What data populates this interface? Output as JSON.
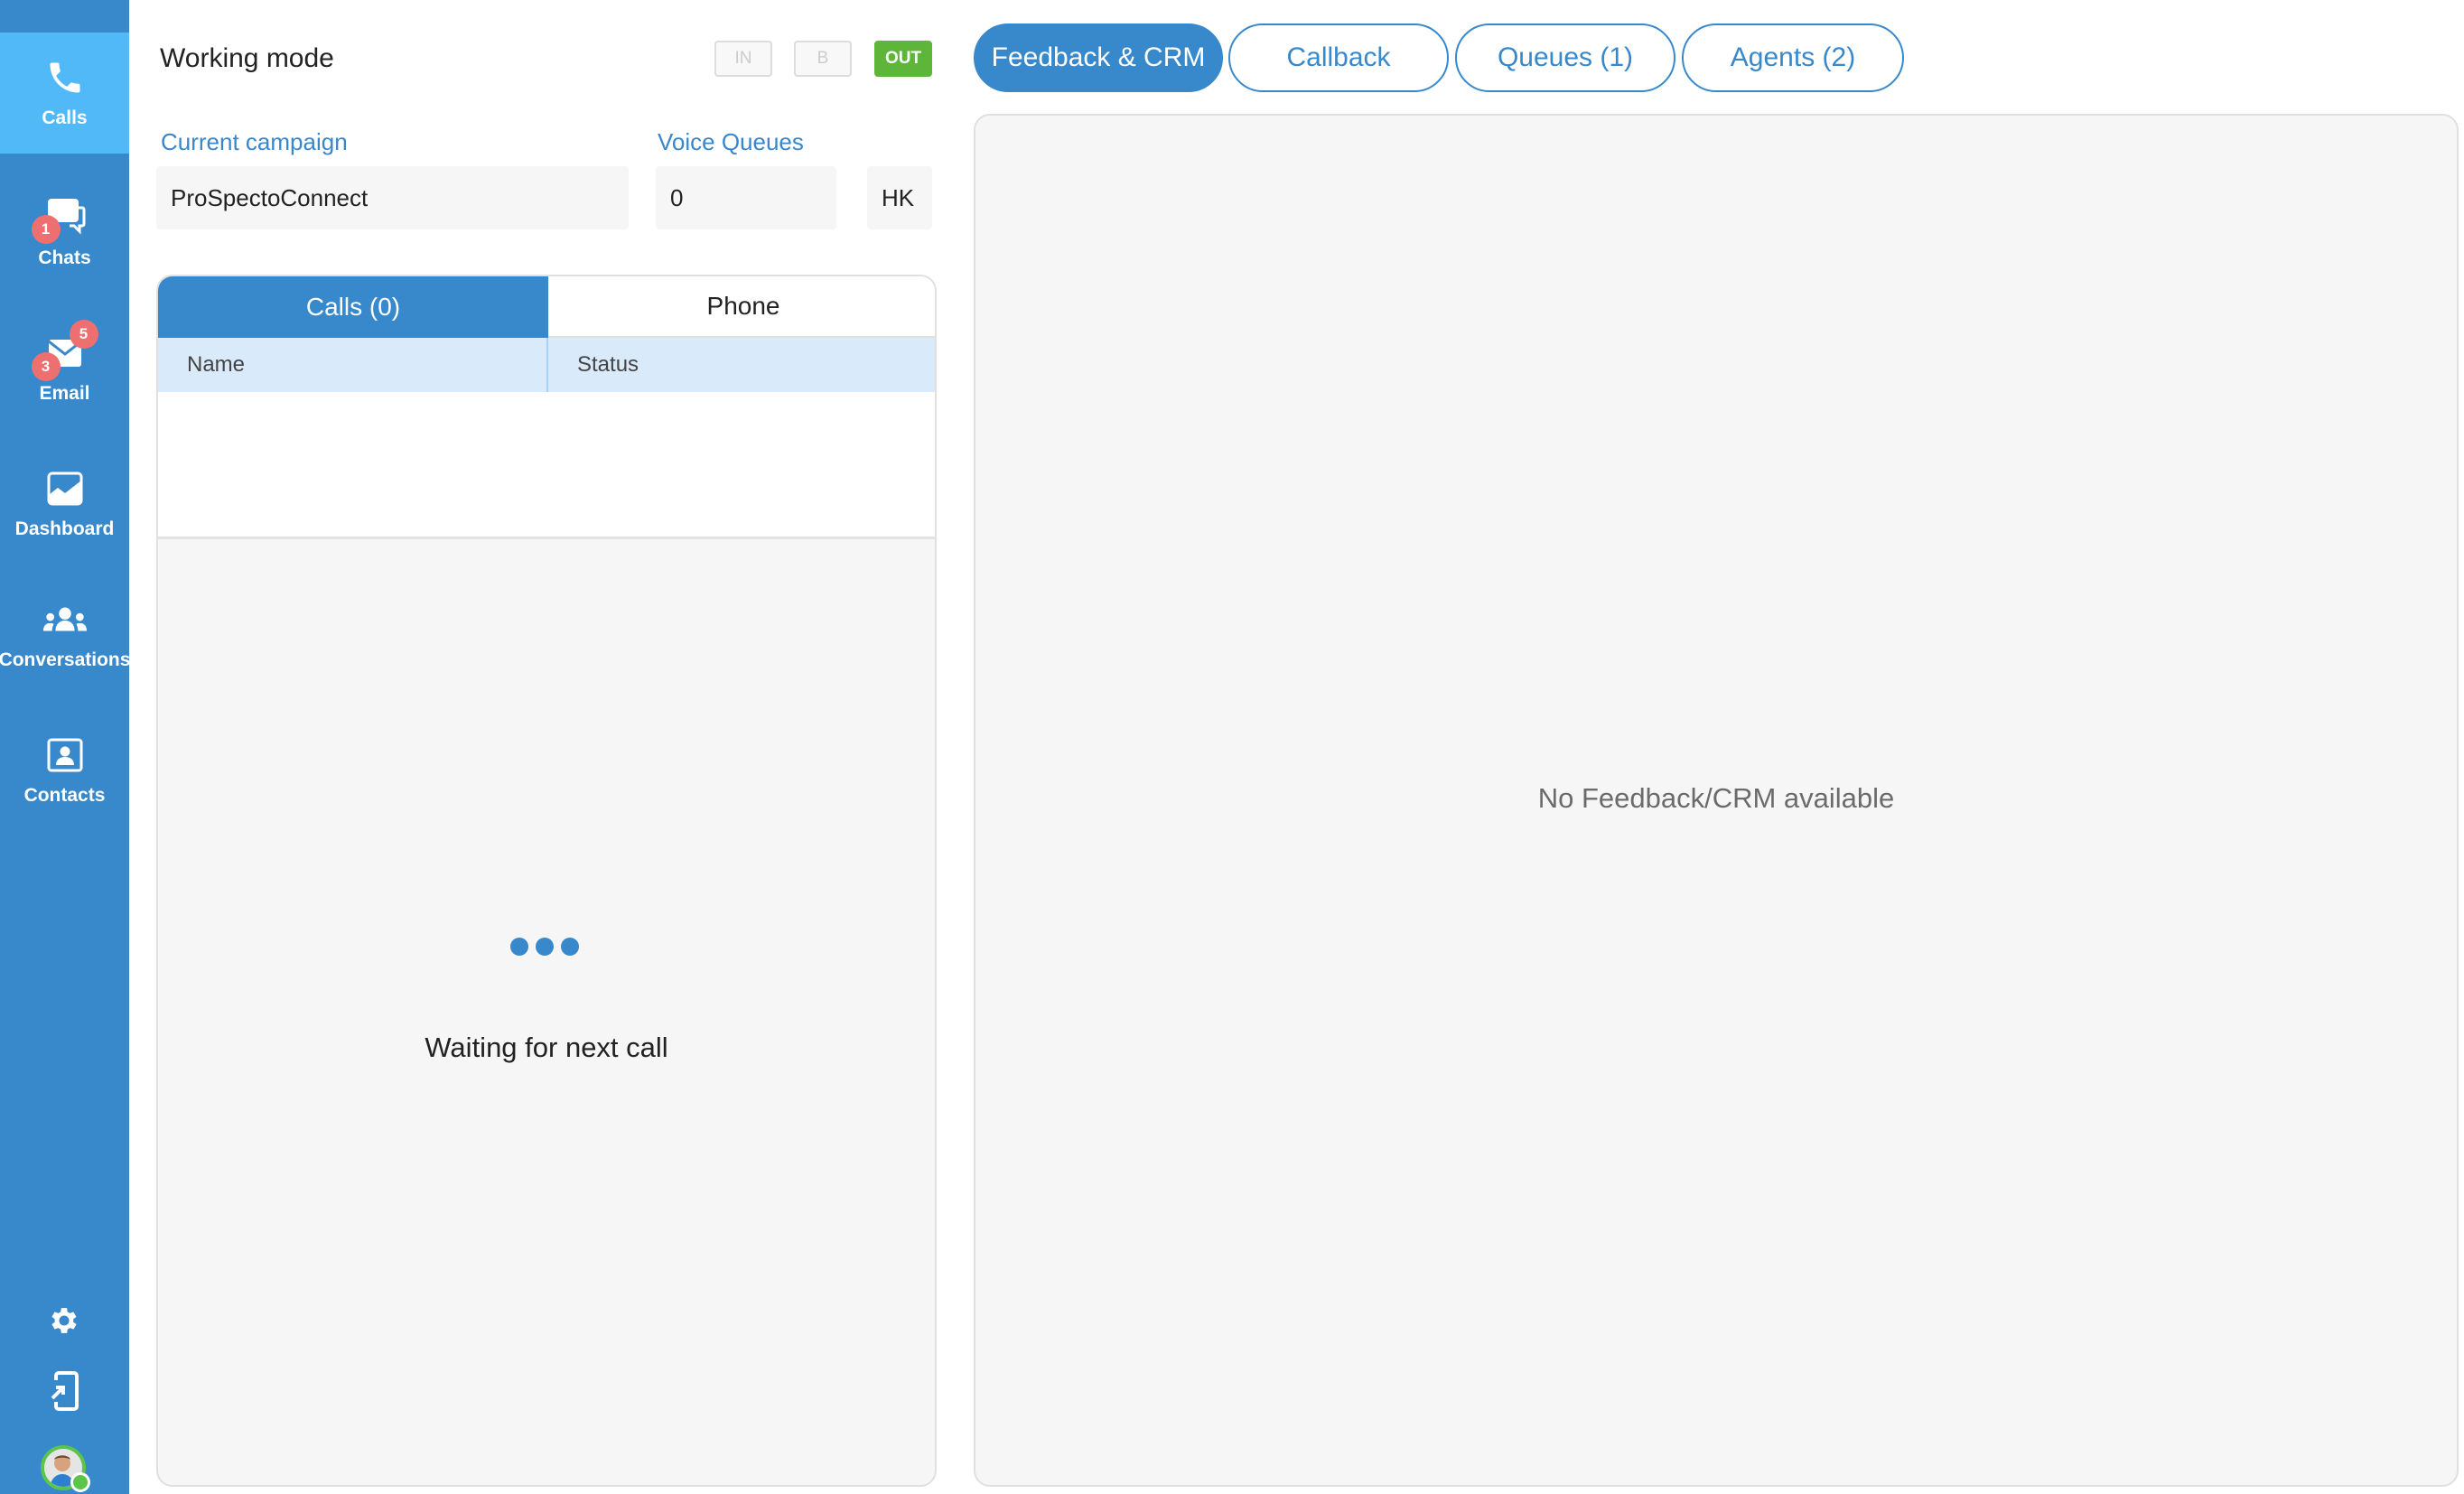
{
  "sidebar": {
    "items": [
      {
        "label": "Calls",
        "icon": "phone-icon",
        "active": true
      },
      {
        "label": "Chats",
        "icon": "chat-bubbles-icon",
        "badges": [
          "1"
        ]
      },
      {
        "label": "Email",
        "icon": "envelope-icon",
        "badges": [
          "3",
          "5"
        ]
      },
      {
        "label": "Dashboard",
        "icon": "chart-icon"
      },
      {
        "label": "Conversations",
        "icon": "group-icon"
      },
      {
        "label": "Contacts",
        "icon": "contact-card-icon"
      }
    ],
    "bottom": [
      "gear-icon",
      "device-login-icon",
      "avatar"
    ]
  },
  "working_mode": {
    "title": "Working mode",
    "buttons": [
      {
        "label": "IN",
        "active": false
      },
      {
        "label": "B",
        "active": false
      },
      {
        "label": "OUT",
        "active": true
      }
    ]
  },
  "campaign": {
    "label": "Current campaign",
    "value": "ProSpectoConnect"
  },
  "voice_queues": {
    "label": "Voice Queues",
    "value": "0",
    "extra": "HK"
  },
  "calls_panel": {
    "tabs": [
      {
        "label": "Calls (0)",
        "active": true
      },
      {
        "label": "Phone",
        "active": false
      }
    ],
    "columns": [
      "Name",
      "Status"
    ],
    "rows": [],
    "waiting_text": "Waiting for next call"
  },
  "right_tabs": [
    {
      "label": "Feedback & CRM",
      "active": true
    },
    {
      "label": "Callback"
    },
    {
      "label": "Queues (1)"
    },
    {
      "label": "Agents (2)"
    }
  ],
  "crm_panel": {
    "empty_text": "No Feedback/CRM available"
  },
  "colors": {
    "primary": "#3888cc",
    "active_nav": "#52b9f8",
    "badge": "#ee6f6f",
    "out_green": "#5db53a"
  }
}
